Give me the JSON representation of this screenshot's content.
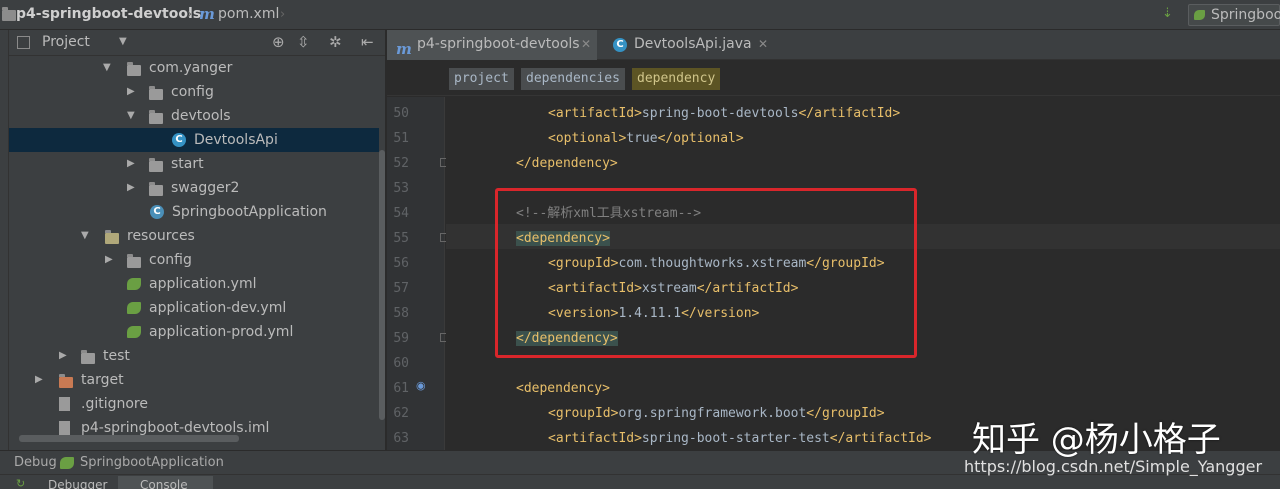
{
  "navbar": {
    "project_name": "p4-springboot-devtools",
    "file_name": "pom.xml",
    "run_config": "Springboo"
  },
  "project_panel": {
    "title": "Project",
    "tree": [
      {
        "label": "com.yanger",
        "icon": "package-folder-icon",
        "expanded": true
      },
      {
        "label": "config",
        "icon": "package-folder-icon",
        "expanded": false
      },
      {
        "label": "devtools",
        "icon": "package-folder-icon",
        "expanded": true
      },
      {
        "label": "DevtoolsApi",
        "icon": "java-class-icon",
        "selected": true
      },
      {
        "label": "start",
        "icon": "package-folder-icon",
        "expanded": false
      },
      {
        "label": "swagger2",
        "icon": "package-folder-icon",
        "expanded": false
      },
      {
        "label": "SpringbootApplication",
        "icon": "spring-boot-class-icon"
      },
      {
        "label": "resources",
        "icon": "resources-folder-icon",
        "expanded": true
      },
      {
        "label": "config",
        "icon": "folder-icon",
        "expanded": false
      },
      {
        "label": "application.yml",
        "icon": "spring-config-icon"
      },
      {
        "label": "application-dev.yml",
        "icon": "spring-config-icon"
      },
      {
        "label": "application-prod.yml",
        "icon": "spring-config-icon"
      },
      {
        "label": "test",
        "icon": "folder-icon",
        "expanded": false
      },
      {
        "label": "target",
        "icon": "excluded-folder-icon",
        "expanded": false
      },
      {
        "label": ".gitignore",
        "icon": "file-icon"
      },
      {
        "label": "p4-springboot-devtools.iml",
        "icon": "file-icon"
      }
    ]
  },
  "editor": {
    "tabs": [
      {
        "label": "p4-springboot-devtools",
        "icon": "maven-icon",
        "active": true
      },
      {
        "label": "DevtoolsApi.java",
        "icon": "java-class-icon",
        "active": false
      }
    ],
    "breadcrumbs": [
      "project",
      "dependencies",
      "dependency"
    ],
    "lines": [
      {
        "num": "50",
        "code": "    <artifactId>spring-boot-devtools</artifactId>"
      },
      {
        "num": "51",
        "code": "    <optional>true</optional>"
      },
      {
        "num": "52",
        "code": "</dependency>"
      },
      {
        "num": "53",
        "code": ""
      },
      {
        "num": "54",
        "code": "<!--解析xml工具xstream-->"
      },
      {
        "num": "55",
        "code": "<dependency>"
      },
      {
        "num": "56",
        "code": "    <groupId>com.thoughtworks.xstream</groupId>"
      },
      {
        "num": "57",
        "code": "    <artifactId>xstream</artifactId>"
      },
      {
        "num": "58",
        "code": "    <version>1.4.11.1</version>"
      },
      {
        "num": "59",
        "code": "</dependency>"
      },
      {
        "num": "60",
        "code": ""
      },
      {
        "num": "61",
        "code": "<dependency>"
      },
      {
        "num": "62",
        "code": "    <groupId>org.springframework.boot</groupId>"
      },
      {
        "num": "63",
        "code": "    <artifactId>spring-boot-starter-test</artifactId>"
      }
    ]
  },
  "debug": {
    "label": "Debug",
    "config": "SpringbootApplication",
    "tabs": [
      "Debugger",
      "Console"
    ]
  },
  "watermark": {
    "line1": "知乎 @杨小格子",
    "line2": "https://blog.csdn.net/Simple_Yangger"
  },
  "colors": {
    "background": "#2b2b2b",
    "panel": "#3c3f41",
    "xml_tag": "#e8bf6a",
    "text": "#a9b7c6",
    "comment": "#808080",
    "highlight_box": "#d9262b"
  }
}
